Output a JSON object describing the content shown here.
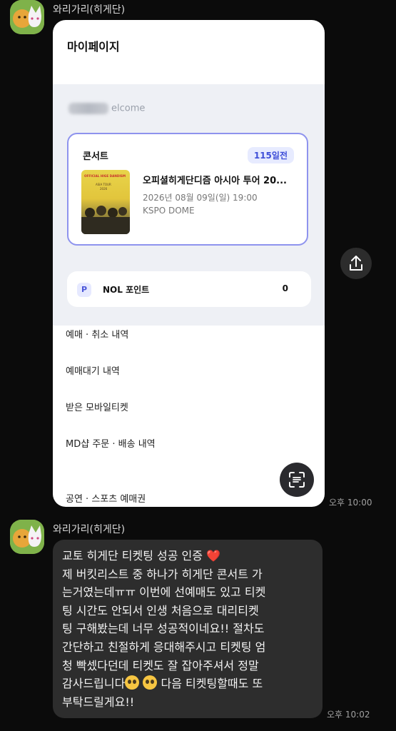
{
  "messages": [
    {
      "sender": "와리가리(히게단)",
      "type": "image",
      "time": "오후 10:00",
      "screenshot": {
        "title": "마이페이지",
        "welcome": "elcome",
        "concert": {
          "category": "콘서트",
          "dday": "115일전",
          "title": "오피셜히게단디즘 아시아 투어 20...",
          "datetime": "2026년 08월 09일(일) 19:00",
          "venue": "KSPO DOME",
          "poster_text": [
            "OFFICIAL HIGE DANDISM",
            "ASIA TOUR",
            "2026"
          ]
        },
        "points": {
          "icon": "P",
          "label": "NOL 포인트",
          "value": "0"
        },
        "menu": [
          "예매 · 취소 내역",
          "예매대기 내역",
          "받은 모바일티켓",
          "MD샵 주문 · 배송 내역",
          "공연 · 스포츠 예매권"
        ]
      }
    },
    {
      "sender": "와리가리(히게단)",
      "type": "text",
      "time": "오후 10:02",
      "lines": {
        "l1": "교토 히게단 티켓팅 성공 인증",
        "l1_emoji": "❤️",
        "l2": "제 버킷리스트 중 하나가 히게단 콘서트 가",
        "l3": "는거였는데ㅠㅠ 이번에 선예매도 있고 티켓",
        "l4": "팅 시간도 안되서 인생 처음으로 대리티켓",
        "l5": "팅 구해봤는데 너무 성공적이네요!! 절차도",
        "l6": "간단하고 친절하게 응대해주시고 티켓팅 엄",
        "l7": "청 빡셌다던데 티켓도 잘 잡아주셔서 정말",
        "l8a": "감사드립니다",
        "l8b": "다음 티켓팅할때도 또",
        "l9": "부탁드릴게요!!"
      }
    }
  ],
  "icons": {
    "avatar": "character-avatar-icon",
    "share": "share-icon",
    "scan": "scan-icon"
  },
  "colors": {
    "background": "#0b0b0b",
    "bubble": "#2d2d2d",
    "accent": "#8e93ee",
    "dday_text": "#3f4fd8"
  }
}
